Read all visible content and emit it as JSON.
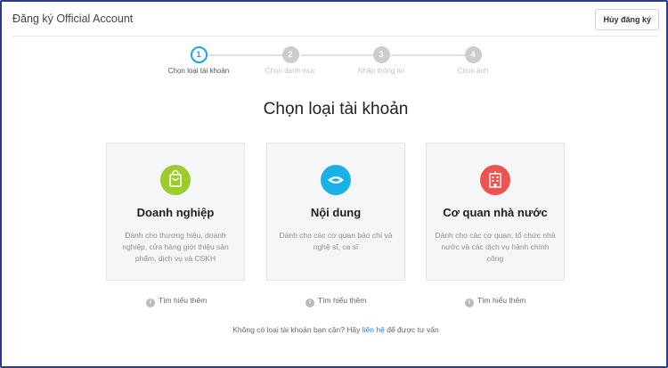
{
  "header": {
    "title": "Đăng ký Official Account",
    "cancel_label": "Hủy đăng ký"
  },
  "stepper": {
    "steps": [
      {
        "number": "1",
        "label": "Chọn loại tài khoản",
        "active": true
      },
      {
        "number": "2",
        "label": "Chọn danh mục",
        "active": false
      },
      {
        "number": "3",
        "label": "Nhập thông tin",
        "active": false
      },
      {
        "number": "4",
        "label": "Chọn ảnh",
        "active": false
      }
    ]
  },
  "main": {
    "title": "Chọn loại tài khoản",
    "cards": [
      {
        "title": "Doanh nghiệp",
        "description": "Dành cho thương hiệu, doanh nghiệp, cửa hàng giới thiệu sản phẩm, dịch vụ và CSKH",
        "icon": "shopping-bag-icon",
        "icon_color": "#9ccc2a",
        "learn_more": "Tìm hiểu thêm"
      },
      {
        "title": "Nội dung",
        "description": "Dành cho các cơ quan báo chí và nghệ sĩ, ca sĩ",
        "icon": "eye-icon",
        "icon_color": "#1ab1e6",
        "learn_more": "Tìm hiểu thêm"
      },
      {
        "title": "Cơ quan nhà nước",
        "description": "Dành cho các cơ quan, tổ chức nhà nước và các dịch vụ hành chính công",
        "icon": "building-icon",
        "icon_color": "#ef5350",
        "learn_more": "Tìm hiểu thêm"
      }
    ]
  },
  "footer": {
    "prefix": "Không có loại tài khoản bạn cần? Hãy",
    "link": "liên hệ",
    "suffix": "để được tư vấn"
  },
  "colors": {
    "accent": "#1aa3e8",
    "frame_border": "#2e3a8c",
    "link": "#1a7ee8"
  }
}
